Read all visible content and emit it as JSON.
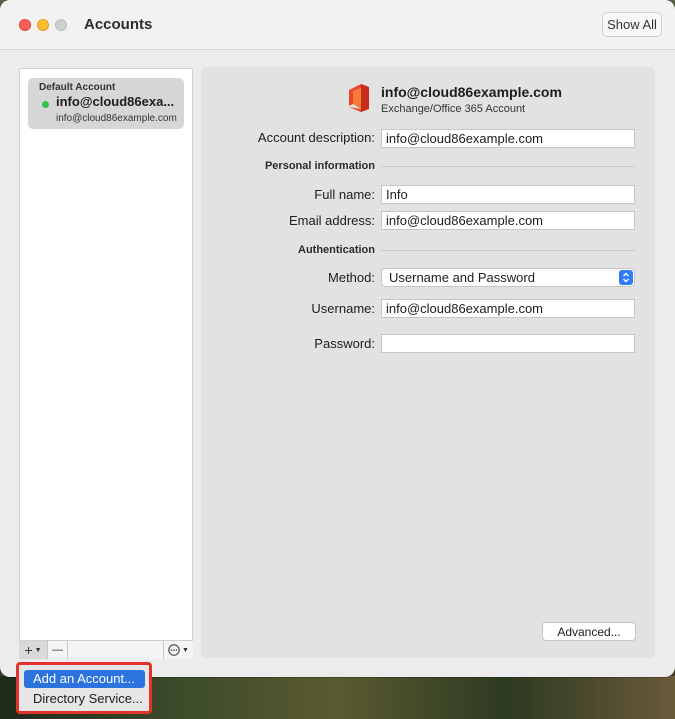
{
  "window": {
    "title": "Accounts",
    "show_all_label": "Show All"
  },
  "sidebar": {
    "accounts": [
      {
        "group_label": "Default Account",
        "name": "info@cloud86exa...",
        "email": "info@cloud86example.com",
        "status_color": "#32c24d"
      }
    ],
    "toolbar": {
      "add_label": "+",
      "remove_label": "—",
      "more_label": "⋯"
    }
  },
  "detail": {
    "header_email": "info@cloud86example.com",
    "header_type": "Exchange/Office 365 Account",
    "account_description_label": "Account description:",
    "account_description_value": "info@cloud86example.com",
    "personal_info_label": "Personal information",
    "full_name_label": "Full name:",
    "full_name_value": "Info",
    "email_label": "Email address:",
    "email_value": "info@cloud86example.com",
    "authentication_label": "Authentication",
    "method_label": "Method:",
    "method_value": "Username and Password",
    "username_label": "Username:",
    "username_value": "info@cloud86example.com",
    "password_label": "Password:",
    "password_value": "",
    "advanced_label": "Advanced..."
  },
  "popup_menu": {
    "items": [
      {
        "label": "Add an Account...",
        "highlighted": true
      },
      {
        "label": "Directory Service...",
        "highlighted": false
      }
    ]
  },
  "colors": {
    "accent": "#2d73e0",
    "highlight_border": "#e0332c"
  }
}
